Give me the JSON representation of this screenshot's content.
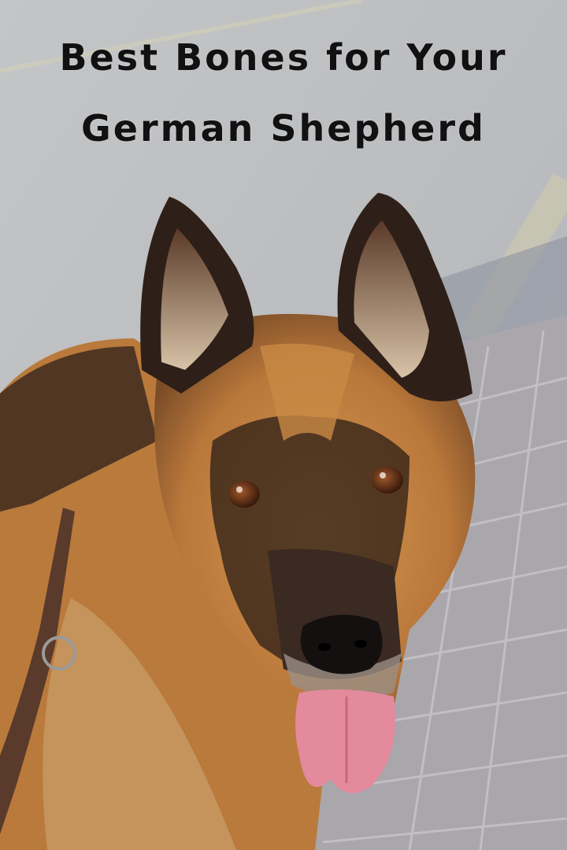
{
  "pin": {
    "title_line_1": "Best Bones for Your",
    "title_line_2": "German Shepherd"
  },
  "colors": {
    "pavement": "#b9bcbf",
    "bricks": "#a9a7ab",
    "fur_tan": "#c98a45",
    "fur_dark": "#3a2a20",
    "tongue": "#e38a9c",
    "leash": "#5a3a2a",
    "title_text": "#111111"
  },
  "icons": [
    "dog-photo",
    "leash-ring"
  ]
}
